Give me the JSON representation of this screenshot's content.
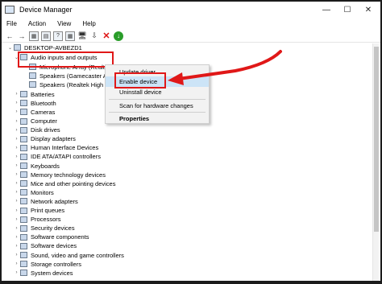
{
  "window": {
    "title": "Device Manager",
    "controls": [
      "—",
      "☐",
      "✕"
    ]
  },
  "menubar": [
    "File",
    "Action",
    "View",
    "Help"
  ],
  "toolbar": [
    "←",
    "→",
    "▦",
    "▤",
    "?",
    "▦",
    "🖥",
    "⇩",
    "✕",
    "↓"
  ],
  "tree": {
    "root": "DESKTOP-AVBEZD1",
    "expanded_category": "Audio inputs and outputs",
    "children": [
      "Microphone Array (Realt",
      "Speakers (Gamecaster Au",
      "Speakers (Realtek High D"
    ],
    "categories": [
      "Batteries",
      "Bluetooth",
      "Cameras",
      "Computer",
      "Disk drives",
      "Display adapters",
      "Human Interface Devices",
      "IDE ATA/ATAPI controllers",
      "Keyboards",
      "Memory technology devices",
      "Mice and other pointing devices",
      "Monitors",
      "Network adapters",
      "Print queues",
      "Processors",
      "Security devices",
      "Software components",
      "Software devices",
      "Sound, video and game controllers",
      "Storage controllers",
      "System devices"
    ]
  },
  "context_menu": {
    "items": [
      "Update driver",
      "Enable device",
      "Uninstall device",
      "Scan for hardware changes",
      "Properties"
    ],
    "highlighted": "Enable device"
  },
  "annotation_color": "#e01818",
  "highlight_color": "#cce4f7"
}
